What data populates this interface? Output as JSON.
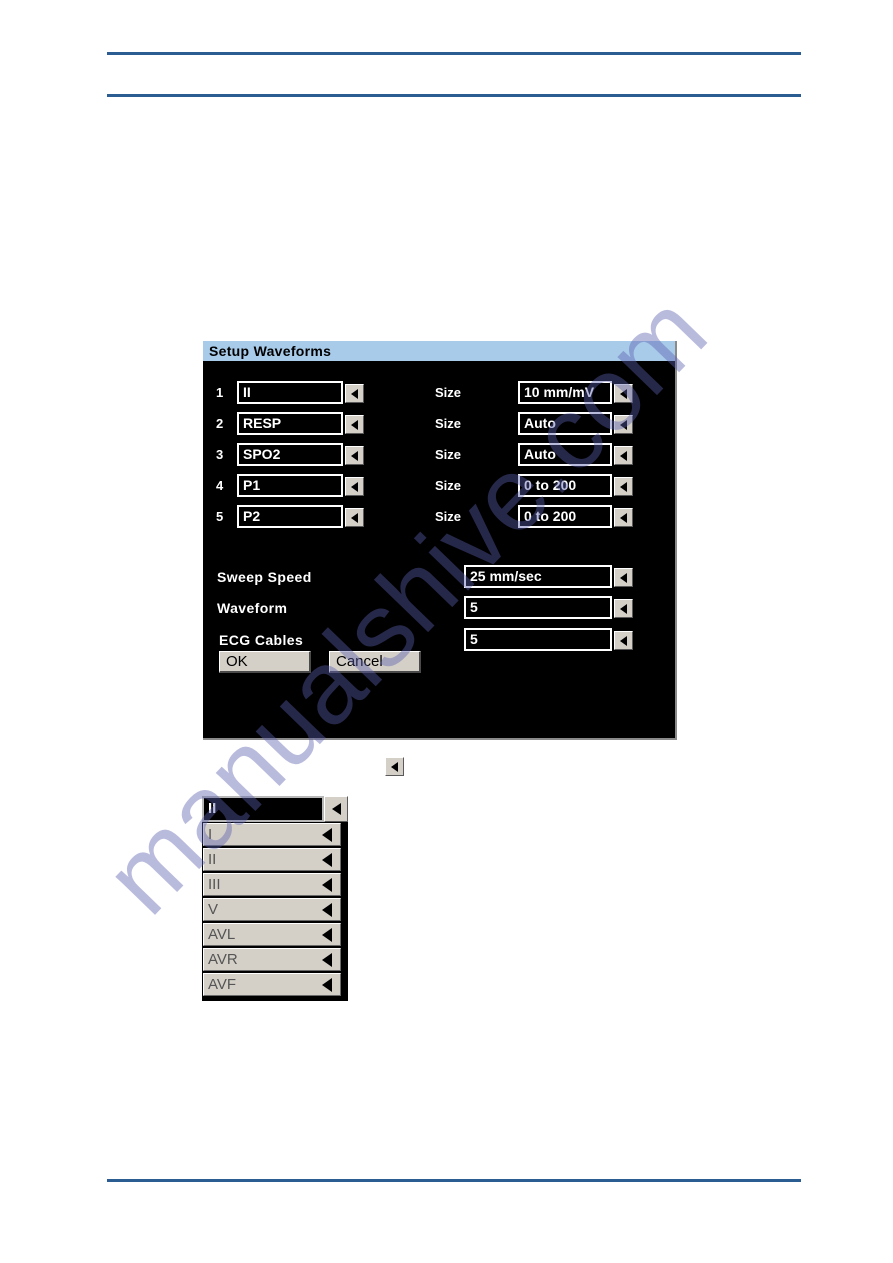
{
  "page": {
    "background_color": "#ffffff",
    "rule_color": "#2c5d92",
    "watermark_text": "manualshive.com"
  },
  "dialog": {
    "title": "Setup Waveforms",
    "titlebar_color": "#a8cbea",
    "body_color": "#000000",
    "waveform_rows": [
      {
        "index": "1",
        "channel": "II",
        "size_label": "Size",
        "size_value": "10 mm/mV"
      },
      {
        "index": "2",
        "channel": "RESP",
        "size_label": "Size",
        "size_value": "Auto"
      },
      {
        "index": "3",
        "channel": "SPO2",
        "size_label": "Size",
        "size_value": "Auto"
      },
      {
        "index": "4",
        "channel": "P1",
        "size_label": "Size",
        "size_value": "0 to 200"
      },
      {
        "index": "5",
        "channel": "P2",
        "size_label": "Size",
        "size_value": "0 to 200"
      }
    ],
    "settings": [
      {
        "label": "Sweep Speed",
        "value": "25 mm/sec"
      },
      {
        "label": "Waveform",
        "value": "5"
      },
      {
        "label": "ECG  Cables",
        "value": "5"
      }
    ],
    "buttons": {
      "ok": "OK",
      "cancel": "Cancel"
    }
  },
  "standalone_arrow": {
    "icon": "left-arrow-icon"
  },
  "dropdown": {
    "selected": "II",
    "items": [
      {
        "label": "I"
      },
      {
        "label": "II"
      },
      {
        "label": "III"
      },
      {
        "label": "V"
      },
      {
        "label": "AVL"
      },
      {
        "label": "AVR"
      },
      {
        "label": "AVF"
      }
    ]
  }
}
